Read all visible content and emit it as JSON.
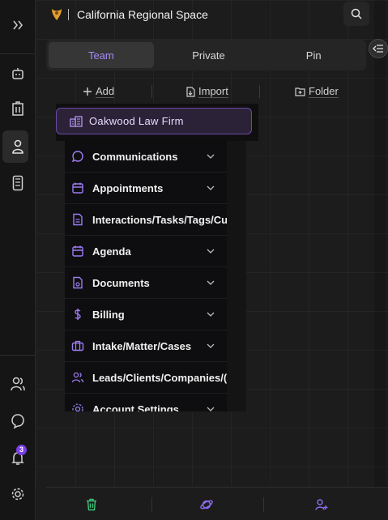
{
  "header": {
    "workspace_title": "California Regional Space",
    "search_icon": "search-icon"
  },
  "tabs": [
    {
      "label": "Team",
      "selected": true
    },
    {
      "label": "Private",
      "selected": false
    },
    {
      "label": "Pin",
      "selected": false
    }
  ],
  "actions": {
    "add_label": "Add",
    "import_label": "Import",
    "folder_label": "Folder"
  },
  "organization": {
    "name": "Oakwood Law Firm"
  },
  "menu": [
    {
      "label": "Communications",
      "icon": "chat-bubble-icon",
      "has_chevron": true
    },
    {
      "label": "Appointments",
      "icon": "calendar-icon",
      "has_chevron": true
    },
    {
      "label": "Interactions/Tasks/Tags/Cu",
      "icon": "document-icon",
      "has_chevron": false
    },
    {
      "label": "Agenda",
      "icon": "calendar-icon",
      "has_chevron": true
    },
    {
      "label": "Documents",
      "icon": "file-icon",
      "has_chevron": true
    },
    {
      "label": "Billing",
      "icon": "dollar-icon",
      "has_chevron": true
    },
    {
      "label": "Intake/Matter/Cases",
      "icon": "briefcase-icon",
      "has_chevron": true
    },
    {
      "label": "Leads/Clients/Companies/(",
      "icon": "users-icon",
      "has_chevron": false
    },
    {
      "label": "Account Settings",
      "icon": "gear-icon",
      "has_chevron": true
    }
  ],
  "rail": {
    "notification_count": "3"
  },
  "colors": {
    "accent": "#a48cf4",
    "selected_org_bg": "#2c2238",
    "badge": "#7b3fe4",
    "footer_trash": "#3fc07a",
    "footer_accent": "#8c6cf0"
  }
}
